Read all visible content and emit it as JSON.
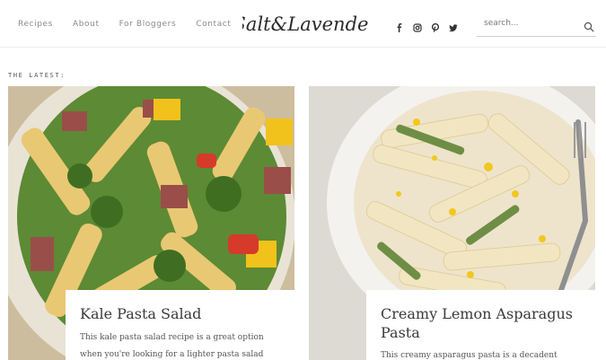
{
  "nav": {
    "items": [
      "Recipes",
      "About",
      "For Bloggers",
      "Contact"
    ]
  },
  "logo": {
    "text": "Salt&Lavender"
  },
  "social": {
    "icons": [
      "facebook-icon",
      "instagram-icon",
      "pinterest-icon",
      "twitter-icon"
    ]
  },
  "search": {
    "placeholder": "search..."
  },
  "section": {
    "heading": "THE LATEST:"
  },
  "posts": [
    {
      "title": "Kale Pasta Salad",
      "excerpt_line1": "This kale pasta salad recipe is a great option",
      "excerpt_line2": "when you're looking for a lighter pasta salad"
    },
    {
      "title_line1": "Creamy Lemon Asparagus",
      "title_line2": "Pasta",
      "excerpt_line1": "This creamy asparagus pasta is a decadent"
    }
  ],
  "colors": {
    "text": "#333333",
    "nav": "#8a8a8a",
    "divider": "#ececec"
  }
}
